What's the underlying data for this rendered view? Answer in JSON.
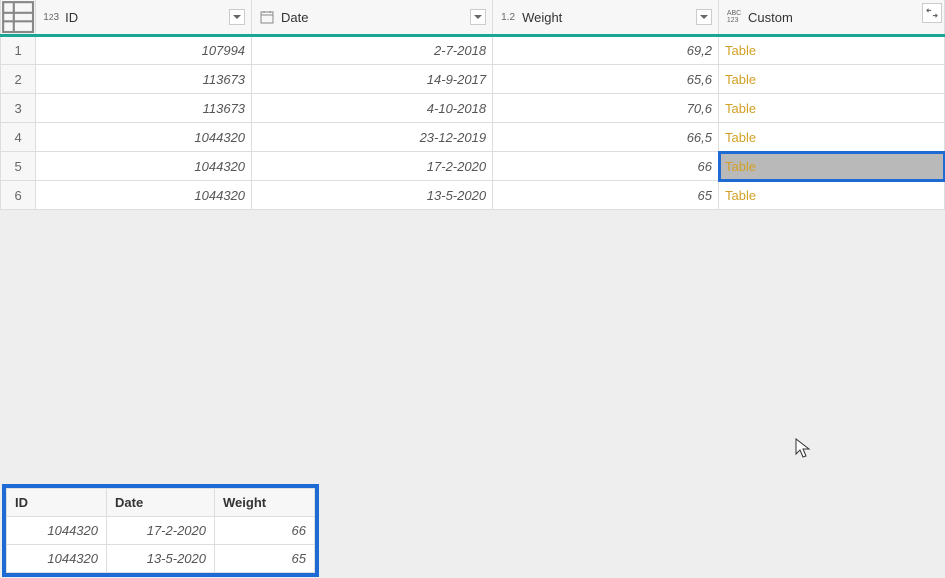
{
  "columns": {
    "id": "ID",
    "date": "Date",
    "weight": "Weight",
    "custom": "Custom"
  },
  "type_labels": {
    "int": "1²3",
    "decimal": "1.2",
    "any": "ABC 123"
  },
  "rows": [
    {
      "n": "1",
      "id": "107994",
      "date": "2-7-2018",
      "weight": "69,2",
      "custom": "Table"
    },
    {
      "n": "2",
      "id": "113673",
      "date": "14-9-2017",
      "weight": "65,6",
      "custom": "Table"
    },
    {
      "n": "3",
      "id": "113673",
      "date": "4-10-2018",
      "weight": "70,6",
      "custom": "Table"
    },
    {
      "n": "4",
      "id": "1044320",
      "date": "23-12-2019",
      "weight": "66,5",
      "custom": "Table"
    },
    {
      "n": "5",
      "id": "1044320",
      "date": "17-2-2020",
      "weight": "66",
      "custom": "Table"
    },
    {
      "n": "6",
      "id": "1044320",
      "date": "13-5-2020",
      "weight": "65",
      "custom": "Table"
    }
  ],
  "selected_row_index": 4,
  "preview": {
    "headers": {
      "id": "ID",
      "date": "Date",
      "weight": "Weight"
    },
    "rows": [
      {
        "id": "1044320",
        "date": "17-2-2020",
        "weight": "66"
      },
      {
        "id": "1044320",
        "date": "13-5-2020",
        "weight": "65"
      }
    ]
  }
}
